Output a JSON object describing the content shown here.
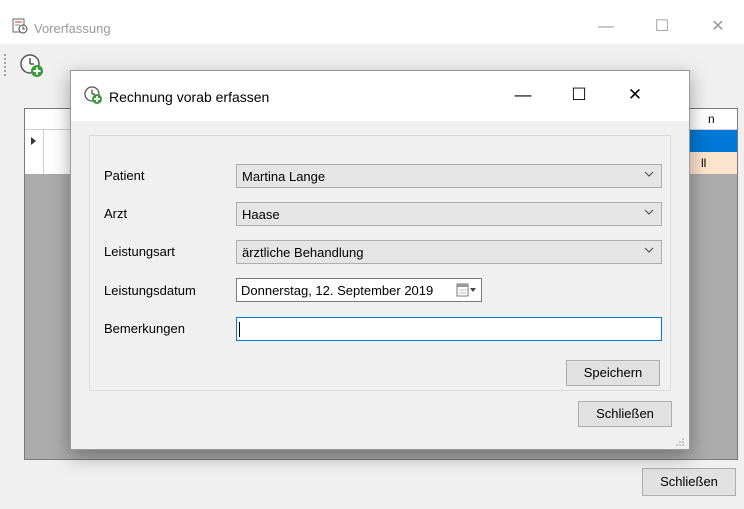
{
  "background_window": {
    "title": "Vorerfassung",
    "grid_header_partial": "n",
    "row2_cell_partial": "ll",
    "close_label": "Schließen",
    "controls": {
      "minimize": "—",
      "maximize": "☐",
      "close": "✕"
    }
  },
  "dialog": {
    "title": "Rechnung vorab erfassen",
    "controls": {
      "minimize": "—",
      "maximize": "☐",
      "close": "✕"
    },
    "fields": {
      "patient": {
        "label": "Patient",
        "value": "Martina Lange"
      },
      "arzt": {
        "label": "Arzt",
        "value": "Haase"
      },
      "leistungsart": {
        "label": "Leistungsart",
        "value": "ärztliche Behandlung"
      },
      "leistungsdatum": {
        "label": "Leistungsdatum",
        "value": "Donnerstag, 12. September 2019"
      },
      "bemerkungen": {
        "label": "Bemerkungen",
        "value": ""
      }
    },
    "save_label": "Speichern",
    "close_label": "Schließen"
  },
  "colors": {
    "accent": "#0078d7",
    "alert_cell": "#fce4cc",
    "button_bg": "#e1e1e1",
    "dialog_bg": "#f0f0f0"
  },
  "icons": {
    "app": "form-clock-icon",
    "new_entry": "clock-plus-icon",
    "dialog": "clock-plus-icon",
    "dropdown": "chevron-down-icon",
    "calendar": "calendar-icon"
  }
}
